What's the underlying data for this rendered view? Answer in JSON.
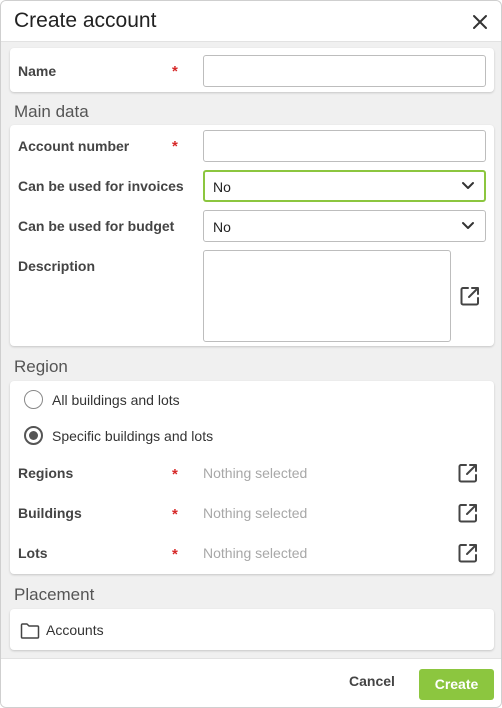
{
  "dialog": {
    "title": "Create account",
    "close_icon": "close-icon"
  },
  "name_field": {
    "label": "Name",
    "required_mark": "*",
    "value": ""
  },
  "main_data": {
    "title": "Main data",
    "account_number": {
      "label": "Account number",
      "required_mark": "*",
      "value": ""
    },
    "invoices": {
      "label": "Can be used for invoices",
      "value": "No"
    },
    "budget": {
      "label": "Can be used for budget",
      "value": "No"
    },
    "description": {
      "label": "Description",
      "value": "",
      "icon": "open-external-icon"
    }
  },
  "region": {
    "title": "Region",
    "options": [
      {
        "label": "All buildings and lots",
        "checked": false
      },
      {
        "label": "Specific buildings and lots",
        "checked": true
      }
    ],
    "fields": [
      {
        "label": "Regions",
        "required_mark": "*",
        "placeholder": "Nothing selected",
        "icon": "open-external-icon"
      },
      {
        "label": "Buildings",
        "required_mark": "*",
        "placeholder": "Nothing selected",
        "icon": "open-external-icon"
      },
      {
        "label": "Lots",
        "required_mark": "*",
        "placeholder": "Nothing selected",
        "icon": "open-external-icon"
      }
    ]
  },
  "placement": {
    "title": "Placement",
    "folder_label": "Accounts",
    "folder_icon": "folder-icon"
  },
  "footer": {
    "cancel_label": "Cancel",
    "create_label": "Create"
  },
  "colors": {
    "accent": "#8cc63f",
    "required": "#d62828"
  }
}
